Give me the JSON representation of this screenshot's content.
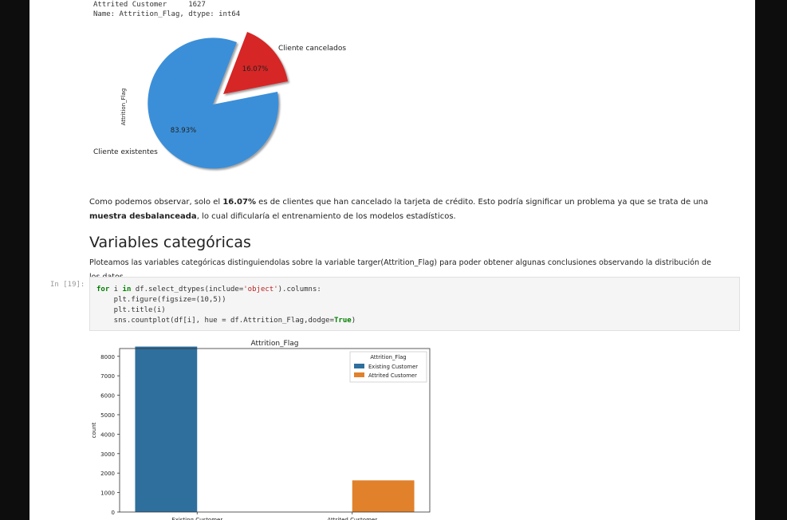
{
  "output_top": {
    "line1": "Attrited Customer     1627",
    "line2": "Name: Attrition_Flag, dtype: int64"
  },
  "pie": {
    "ylabel": "Attrition_Flag",
    "labels": [
      "Cliente existentes",
      "Cliente cancelados"
    ],
    "pcts": [
      "83.93%",
      "16.07%"
    ],
    "colors": [
      "#3a8fd8",
      "#d62728"
    ]
  },
  "markdown": {
    "p1_a": "Como podemos observar, solo el ",
    "p1_b": "16.07%",
    "p1_c": " es de clientes que han cancelado la tarjeta de crédito. Esto podría significar un problema ya que se trata de una ",
    "p1_d": "muestra desbalanceada",
    "p1_e": ", lo cual dificularía el entrenamiento de los modelos estadísticos.",
    "heading": "Variables categóricas",
    "p2": "Ploteamos las variables categóricas distinguiendolas sobre la variable targer(Attrition_Flag) para poder obtener algunas conclusiones observando la distribución de los datos"
  },
  "cell": {
    "prompt": "In [19]:",
    "lines": [
      {
        "kw": "for",
        "t1": " i ",
        "kw2": "in",
        "t2": " df.select_dtypes(include=",
        "str": "'object'",
        "t3": ").columns:"
      },
      {
        "plain": "    plt.figure(figsize=(10,5))"
      },
      {
        "plain": "    plt.title(i)"
      },
      {
        "pre": "    sns.countplot(df[i], hue = df.Attrition_Flag,dodge=",
        "kwend": "True",
        "post": ")"
      }
    ]
  },
  "chart_data": {
    "type": "bar",
    "title": "Attrition_Flag",
    "ylabel": "count",
    "categories": [
      "Existing Customer",
      "Attrited Customer"
    ],
    "series": [
      {
        "name": "Existing Customer",
        "values": [
          8500,
          0
        ],
        "color": "#2e6f9e"
      },
      {
        "name": "Attrited Customer",
        "values": [
          0,
          1627
        ],
        "color": "#e1812c"
      }
    ],
    "ylim": [
      0,
      8400
    ],
    "yticks": [
      0,
      1000,
      2000,
      3000,
      4000,
      5000,
      6000,
      7000,
      8000
    ],
    "legend_title": "Attrition_Flag",
    "legend_position": "top-right"
  }
}
